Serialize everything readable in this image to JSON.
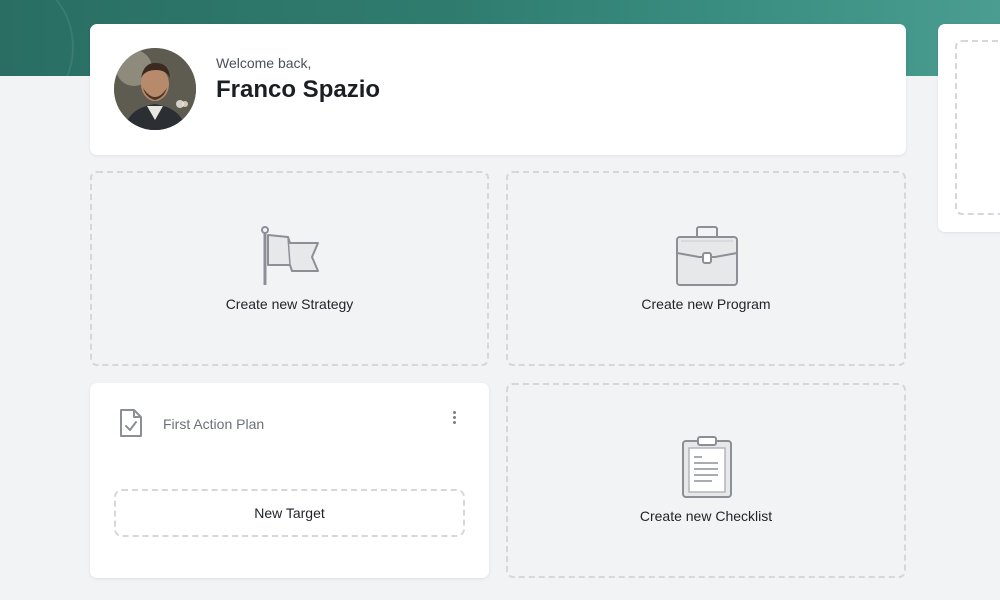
{
  "welcome": {
    "greeting": "Welcome back,",
    "user_name": "Franco Spazio"
  },
  "tiles": {
    "strategy_label": "Create new Strategy",
    "program_label": "Create new Program",
    "checklist_label": "Create new Checklist"
  },
  "action_plan": {
    "title": "First Action Plan",
    "new_target_label": "New Target"
  },
  "icons": {
    "strategy": "flag-icon",
    "program": "briefcase-icon",
    "checklist": "clipboard-icon",
    "plan": "document-check-icon",
    "menu": "more-vertical-icon"
  },
  "colors": {
    "banner": "#2f7c6f",
    "background": "#f2f3f5",
    "card": "#ffffff",
    "dashed_border": "#d4d7db",
    "icon_stroke": "#8c9096"
  }
}
